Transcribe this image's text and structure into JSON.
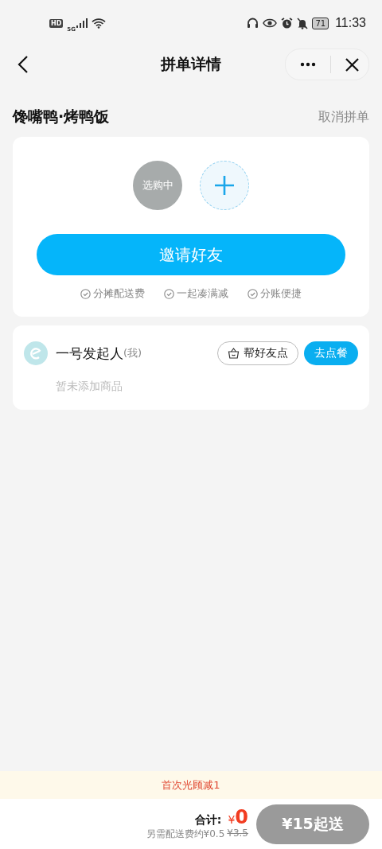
{
  "status_bar": {
    "hd": "HD",
    "network": "5G",
    "battery": "71",
    "time": "11:33"
  },
  "nav": {
    "title": "拼单详情"
  },
  "store": {
    "name": "馋嘴鸭·烤鸭饭",
    "cancel": "取消拼单"
  },
  "invite": {
    "members": [
      {
        "kind": "member",
        "label": "选购中"
      },
      {
        "kind": "add"
      }
    ],
    "button": "邀请好友",
    "benefits": [
      "分摊配送费",
      "一起凑满减",
      "分账便捷"
    ]
  },
  "participants": [
    {
      "name": "一号发起人",
      "tag": "(我)",
      "help_button": "帮好友点",
      "order_button": "去点餐",
      "empty": "暂未添加商品"
    }
  ],
  "promo": "首次光顾减1",
  "checkout": {
    "total_label": "合计:",
    "currency": "¥",
    "amount": "0",
    "fee": "另需配送费约¥0.5",
    "fee_original": "¥3.5",
    "button": "¥15起送",
    "disabled": true
  }
}
